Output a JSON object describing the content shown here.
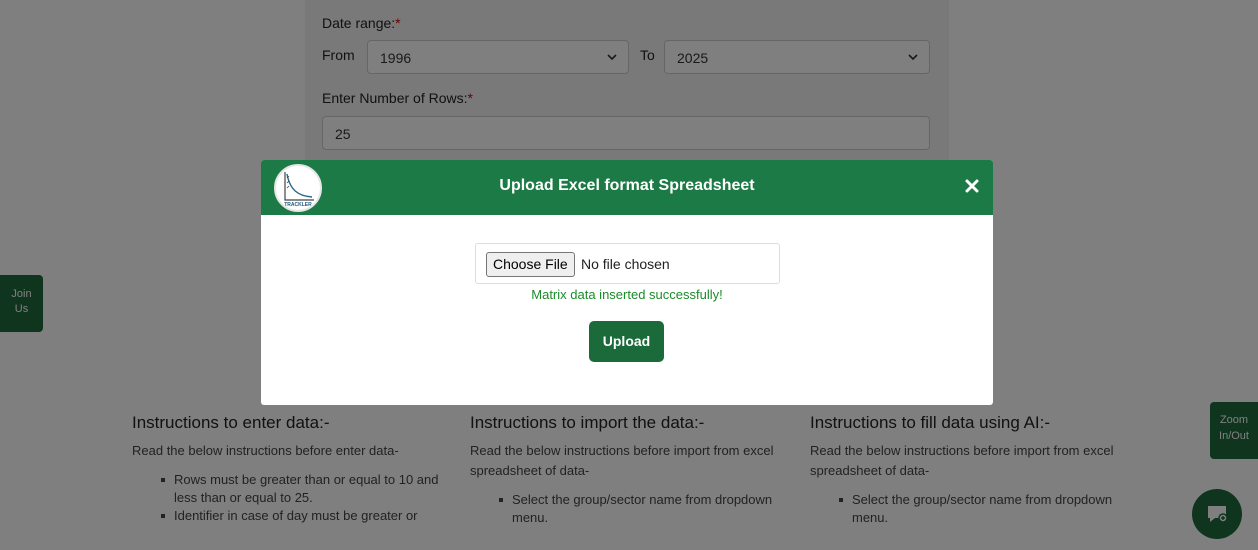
{
  "form": {
    "date_range_label": "Date range:",
    "required_mark": "*",
    "from_label": "From",
    "from_value": "1996",
    "to_label": "To",
    "to_value": "2025",
    "rows_label": "Enter Number of Rows:",
    "rows_value": "25"
  },
  "modal": {
    "title": "Upload Excel format Spreadsheet",
    "logo_text": "TRACKLER",
    "choose_file_label": "Choose File",
    "no_file_text": "No file chosen",
    "success_message": "Matrix data inserted successfully!",
    "upload_label": "Upload"
  },
  "instructions": [
    {
      "title": "Instructions to enter data:-",
      "intro": "Read the below instructions before enter data-",
      "items": [
        "Rows must be greater than or equal to 10 and less than or equal to 25.",
        "Identifier in case of day must be greater or"
      ]
    },
    {
      "title": "Instructions to import the data:-",
      "intro": "Read the below instructions before import from excel spreadsheet of data-",
      "items": [
        "Select the group/sector name from dropdown menu."
      ]
    },
    {
      "title": "Instructions to fill data using AI:-",
      "intro": "Read the below instructions before import from excel spreadsheet of data-",
      "items": [
        "Select the group/sector name from dropdown menu."
      ]
    }
  ],
  "side": {
    "join_label_1": "Join",
    "join_label_2": "Us",
    "zoom_label_1": "Zoom",
    "zoom_label_2": "In/Out"
  },
  "colors": {
    "brand_green": "#1b7a45",
    "success_green": "#1a8c2a",
    "required_red": "#d00000"
  }
}
